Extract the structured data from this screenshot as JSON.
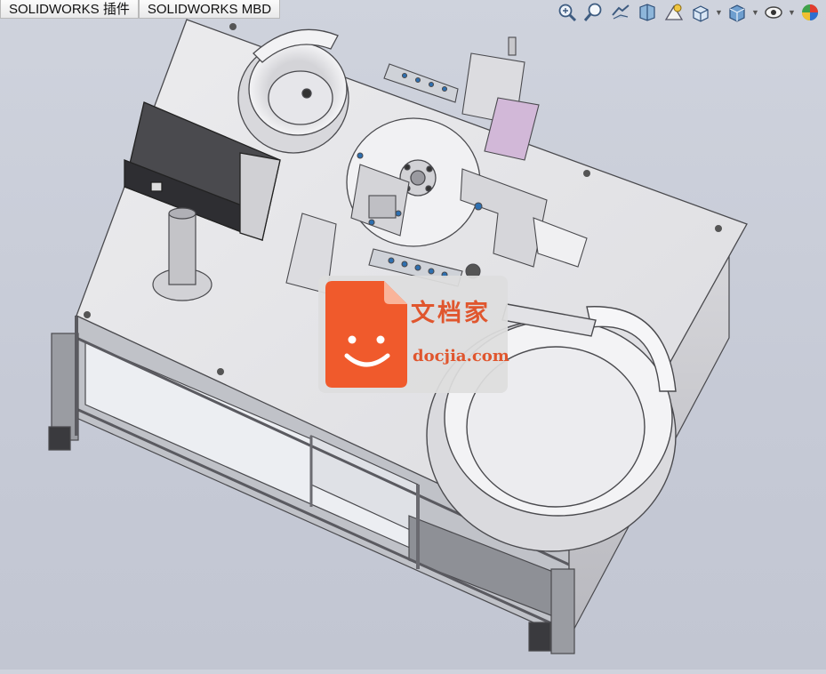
{
  "tabs": [
    {
      "label": "SOLIDWORKS 插件"
    },
    {
      "label": "SOLIDWORKS MBD"
    }
  ],
  "toolbar": {
    "icons": [
      "zoom-to-fit-icon",
      "zoom-to-area-icon",
      "previous-view-icon",
      "section-view-icon",
      "dynamic-annotation-icon",
      "view-orientation-icon",
      "display-style-icon",
      "hide-show-items-icon",
      "edit-appearance-icon"
    ]
  },
  "watermark": {
    "chinese": "文档家",
    "url": "docjia.com",
    "accent_color": "#f05a2c"
  },
  "colors": {
    "background": "#c8ccd8",
    "model_gray": "#e6e6e8"
  }
}
